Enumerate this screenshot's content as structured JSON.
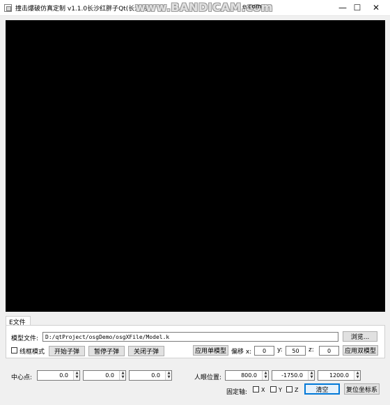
{
  "window": {
    "title": "撞击爆破仿真定制 v1.1.0长沙红胖子Qt(长沙创",
    "watermark": "www.BANDICAM.com",
    "title_suffix": "e.com",
    "minimize_glyph": "—",
    "maximize_glyph": "☐",
    "close_glyph": "✕"
  },
  "tab": {
    "label": "E文件"
  },
  "model": {
    "label": "模型文件:",
    "path": "D:/qtProject/osgDemo/osgXFile/Model.k",
    "browse": "浏览..."
  },
  "controls": {
    "wireframe_label": "线框模式",
    "start_bullet": "开始子弹",
    "pause_bullet": "暂停子弹",
    "stop_bullet": "关闭子弹",
    "apply_single": "应用单模型",
    "offset_label": "偏移 x:",
    "x_value": "0",
    "y_label": "y:",
    "y_value": "50",
    "z_label": "z:",
    "z_value": "0",
    "apply_double": "应用双模型"
  },
  "bottom": {
    "center_label": "中心点:",
    "center_values": [
      "0.0",
      "0.0",
      "0.0"
    ],
    "eye_label": "人眼位置:",
    "eye_values": [
      "800.0",
      "-1750.0",
      "1200.0"
    ],
    "fixed_axis_label": "固定轴:",
    "axis_x": "X",
    "axis_y": "Y",
    "axis_z": "Z",
    "clear": "清空",
    "reset_axes": "复位坐标系"
  }
}
